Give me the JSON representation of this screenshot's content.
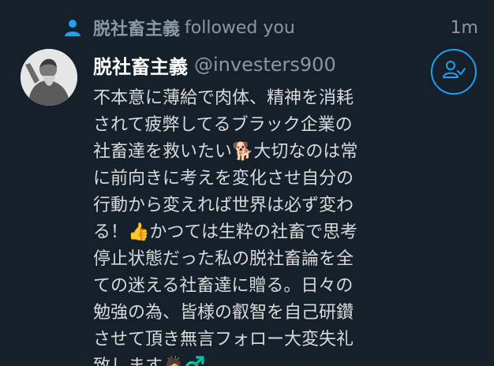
{
  "notification": {
    "follower_name": "脱社畜主義",
    "followed_text": "followed you",
    "timestamp": "1m"
  },
  "profile": {
    "display_name": "脱社畜主義",
    "handle": "@investers900",
    "bio": "不本意に薄給で肉体、精神を消耗\nされて疲弊してるブラック企業の\n社畜達を救いたい🐕大切なのは常\nに前向きに考えを変化させ自分の\n行動から変えれば世界は必ず変わ\nる！👍かつては生粋の社畜で思考\n停止状態だった私の脱社畜論を全\nての迷える社畜達に贈る。日々の\n勉強の為、皆様の叡智を自己研鑽\nさせて頂き無言フォロー大変失礼\n致します🙇♂️"
  },
  "icons": {
    "header": "person-icon",
    "follow_back": "follow-back-icon",
    "avatar": "avatar"
  },
  "colors": {
    "background": "#15202b",
    "accent": "#1da1f2",
    "muted_text": "#8899a6",
    "primary_text": "#ffffff",
    "bio_text": "#d9d9d9"
  }
}
